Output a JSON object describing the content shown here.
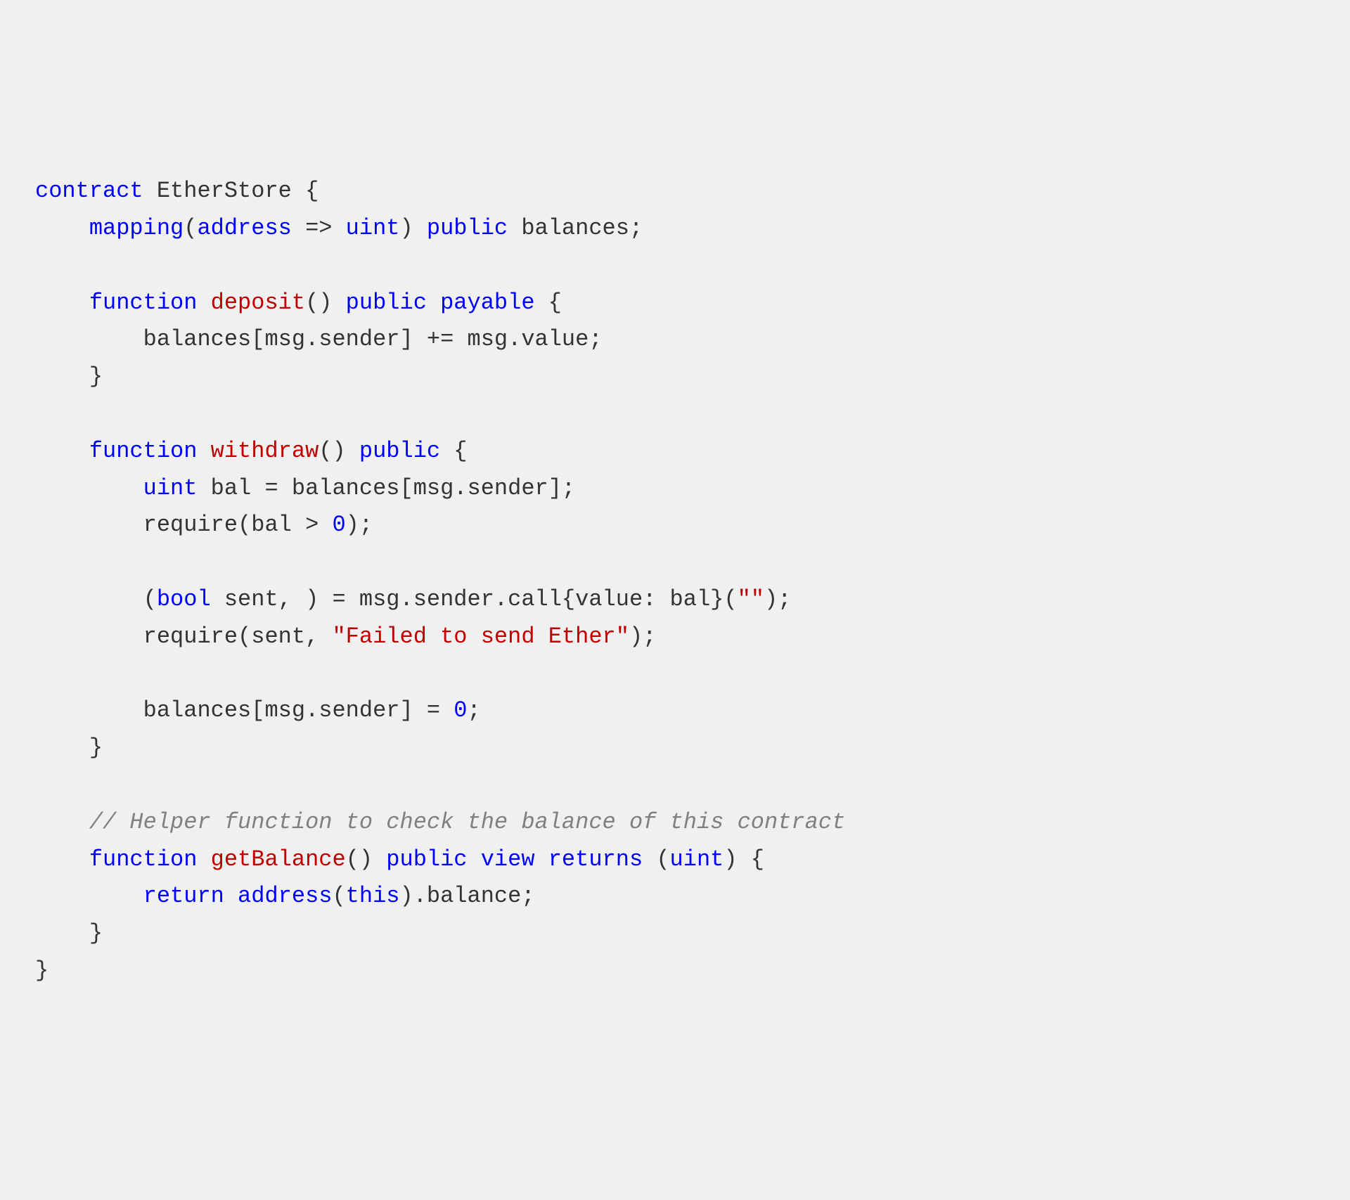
{
  "code": {
    "line1": {
      "t1": "contract",
      "t2": " EtherStore {"
    },
    "line2": {
      "t1": "    ",
      "t2": "mapping",
      "t3": "(",
      "t4": "address",
      "t5": " => ",
      "t6": "uint",
      "t7": ") ",
      "t8": "public",
      "t9": " balances;"
    },
    "line3": "",
    "line4": {
      "t1": "    ",
      "t2": "function",
      "t3": " ",
      "t4": "deposit",
      "t5": "() ",
      "t6": "public",
      "t7": " ",
      "t8": "payable",
      "t9": " {"
    },
    "line5": {
      "t1": "        balances[msg.sender] += msg.value;"
    },
    "line6": {
      "t1": "    }"
    },
    "line7": "",
    "line8": {
      "t1": "    ",
      "t2": "function",
      "t3": " ",
      "t4": "withdraw",
      "t5": "() ",
      "t6": "public",
      "t7": " {"
    },
    "line9": {
      "t1": "        ",
      "t2": "uint",
      "t3": " bal = balances[msg.sender];"
    },
    "line10": {
      "t1": "        require(bal > ",
      "t2": "0",
      "t3": ");"
    },
    "line11": "",
    "line12": {
      "t1": "        (",
      "t2": "bool",
      "t3": " sent, ) = msg.sender.call{value: bal}(",
      "t4": "\"\"",
      "t5": ");"
    },
    "line13": {
      "t1": "        require(sent, ",
      "t2": "\"Failed to send Ether\"",
      "t3": ");"
    },
    "line14": "",
    "line15": {
      "t1": "        balances[msg.sender] = ",
      "t2": "0",
      "t3": ";"
    },
    "line16": {
      "t1": "    }"
    },
    "line17": "",
    "line18": {
      "t1": "    ",
      "t2": "// Helper function to check the balance of this contract"
    },
    "line19": {
      "t1": "    ",
      "t2": "function",
      "t3": " ",
      "t4": "getBalance",
      "t5": "() ",
      "t6": "public",
      "t7": " ",
      "t8": "view",
      "t9": " ",
      "t10": "returns",
      "t11": " (",
      "t12": "uint",
      "t13": ") {"
    },
    "line20": {
      "t1": "        ",
      "t2": "return",
      "t3": " ",
      "t4": "address",
      "t5": "(",
      "t6": "this",
      "t7": ").balance;"
    },
    "line21": {
      "t1": "    }"
    },
    "line22": {
      "t1": "}"
    }
  }
}
